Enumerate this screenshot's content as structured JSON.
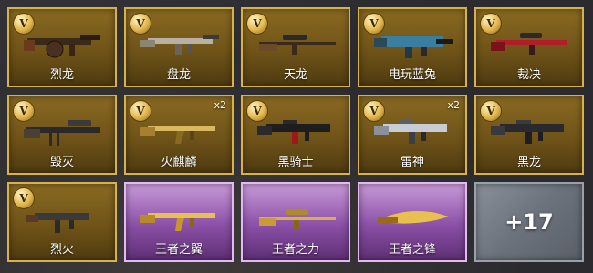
{
  "items": [
    {
      "name": "烈龙",
      "badge": "V",
      "rarity": "gold",
      "icon": "tommy-gun-icon"
    },
    {
      "name": "盘龙",
      "badge": "V",
      "rarity": "gold",
      "icon": "assault-rifle-icon"
    },
    {
      "name": "天龙",
      "badge": "V",
      "rarity": "gold",
      "icon": "sniper-rifle-icon"
    },
    {
      "name": "电玩蓝兔",
      "badge": "V",
      "rarity": "gold",
      "icon": "smg-icon"
    },
    {
      "name": "裁决",
      "badge": "V",
      "rarity": "gold",
      "icon": "sniper-rifle-icon"
    },
    {
      "name": "毁灭",
      "badge": "V",
      "rarity": "gold",
      "icon": "heavy-sniper-icon"
    },
    {
      "name": "火麒麟",
      "badge": "V",
      "rarity": "gold",
      "qty": "x2",
      "icon": "ak-rifle-icon"
    },
    {
      "name": "黑骑士",
      "badge": "V",
      "rarity": "gold",
      "icon": "m4-rifle-icon"
    },
    {
      "name": "雷神",
      "badge": "V",
      "rarity": "gold",
      "qty": "x2",
      "icon": "m4-rifle-icon"
    },
    {
      "name": "黑龙",
      "badge": "V",
      "rarity": "gold",
      "icon": "m4-rifle-icon"
    },
    {
      "name": "烈火",
      "badge": "V",
      "rarity": "gold",
      "icon": "smg-icon"
    },
    {
      "name": "王者之翼",
      "rarity": "purple",
      "icon": "ak-rifle-icon"
    },
    {
      "name": "王者之力",
      "rarity": "purple",
      "icon": "sniper-rifle-icon"
    },
    {
      "name": "王者之锋",
      "rarity": "purple",
      "icon": "knife-icon"
    }
  ],
  "more": {
    "label": "+17"
  },
  "colors": {
    "gold_border": "#d7b24a",
    "purple_border": "#e6b8f2",
    "more_bg": "#6c727c"
  }
}
